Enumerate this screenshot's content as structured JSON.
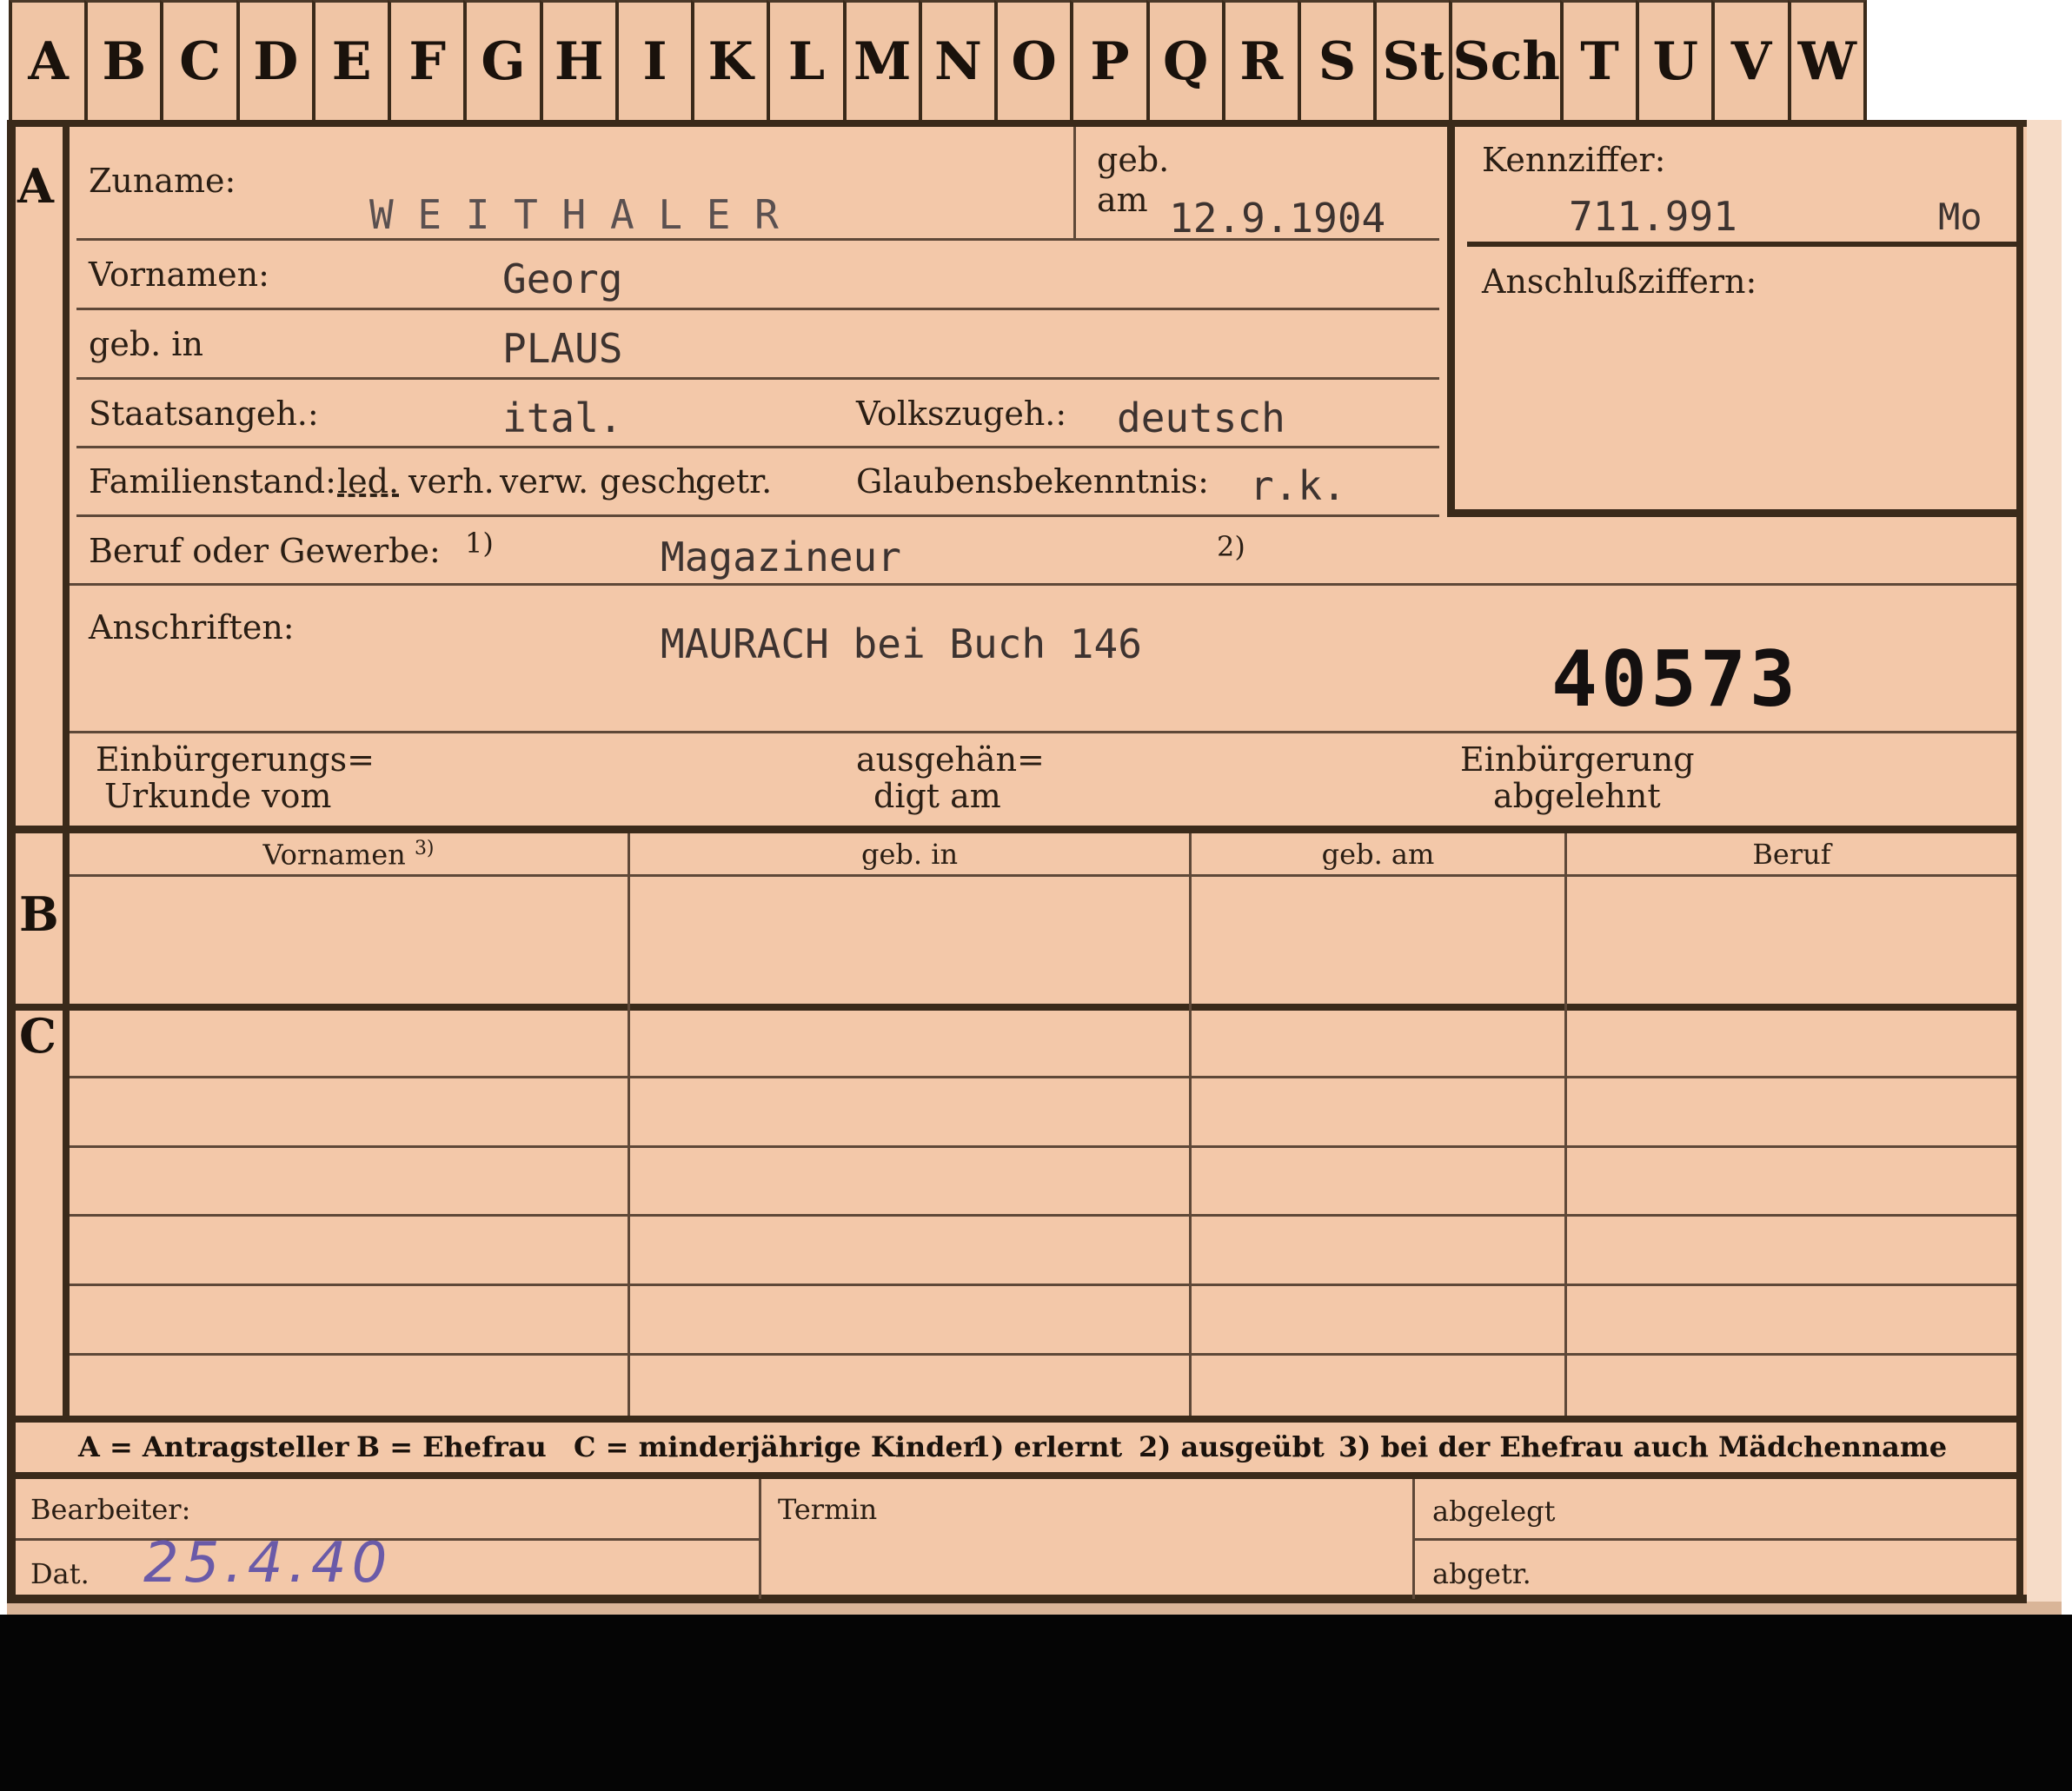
{
  "tabs": [
    "A",
    "B",
    "C",
    "D",
    "E",
    "F",
    "G",
    "H",
    "I",
    "K",
    "L",
    "M",
    "N",
    "O",
    "P",
    "Q",
    "R",
    "S",
    "St",
    "Sch",
    "T",
    "U",
    "V",
    "W"
  ],
  "sections": {
    "a": "A",
    "b": "B",
    "c": "C"
  },
  "fields": {
    "zuname_label": "Zuname:",
    "zuname_value": "W E I T H A L E R",
    "geb_label_1": "geb.",
    "geb_label_2": "am",
    "geb_am_value": "12.9.1904",
    "kennziffer_label": "Kennziffer:",
    "kennziffer_value": "711.991",
    "kennziffer_suffix": "Mo",
    "anschluss_label": "Anschlußziffern:",
    "vornamen_label": "Vornamen:",
    "vornamen_value": "Georg",
    "geb_in_label": "geb. in",
    "geb_in_value": "PLAUS",
    "staatsangeh_label": "Staatsangeh.:",
    "staatsangeh_value": "ital.",
    "volkszugeh_label": "Volkszugeh.:",
    "volkszugeh_value": "deutsch",
    "familienstand_label": "Familienstand:",
    "familienstand_options": [
      "led.",
      "verh.",
      "verw.",
      "gesch.",
      "getr."
    ],
    "glaubens_label": "Glaubensbekenntnis:",
    "glaubens_value": "r.k.",
    "beruf_label": "Beruf oder Gewerbe:",
    "beruf_note_1": "1)",
    "beruf_value": "Magazineur",
    "beruf_note_2": "2)",
    "anschriften_label": "Anschriften:",
    "anschriften_value": "MAURACH bei Buch 146",
    "stamp_number": "40573",
    "einbuergerung_urkunde_1": "Einbürgerungs=",
    "einbuergerung_urkunde_2": "Urkunde vom",
    "ausgehaendigt_1": "ausgehän=",
    "ausgehaendigt_2": "digt am",
    "einbuergerung_abgelehnt_1": "Einbürgerung",
    "einbuergerung_abgelehnt_2": "abgelehnt"
  },
  "table_headers": {
    "vornamen": "Vornamen",
    "vornamen_note": "3)",
    "geb_in": "geb. in",
    "geb_am": "geb. am",
    "beruf": "Beruf"
  },
  "legend": {
    "a": "A = Antragsteller",
    "b": "B = Ehefrau",
    "c": "C = minderjährige Kinder",
    "n1": "1) erlernt",
    "n2": "2) ausgeübt",
    "n3": "3) bei der Ehefrau auch Mädchenname"
  },
  "footer": {
    "bearbeiter_label": "Bearbeiter:",
    "dat_label": "Dat.",
    "dat_value": "25.4.40",
    "termin_label": "Termin",
    "abgelegt_label": "abgelegt",
    "abgetr_label": "abgetr."
  },
  "colors": {
    "card": "#f3c8a9",
    "ink": "#2a1e14",
    "typewriter": "#3d3330",
    "pencil": "#6a5aa8"
  }
}
